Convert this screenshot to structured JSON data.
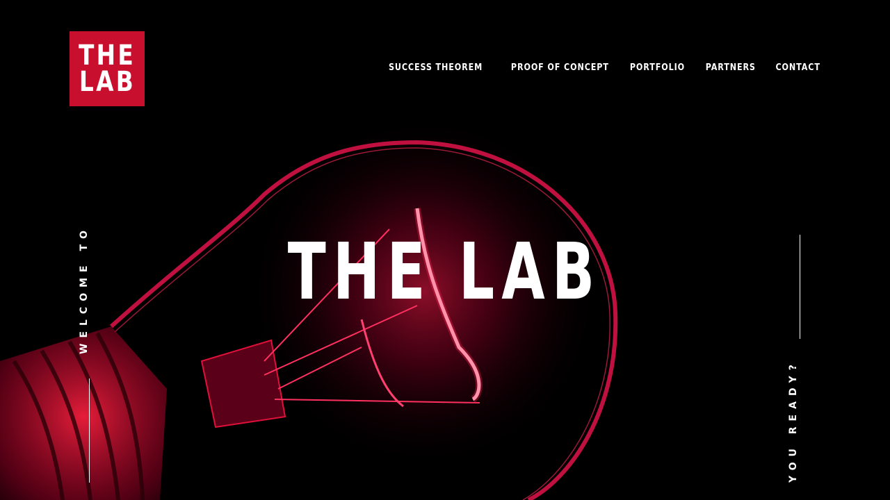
{
  "logo": {
    "line1": "THE",
    "line2": "LAB",
    "color": "#c8102e"
  },
  "nav": {
    "items": [
      {
        "label": "SUCCESS THEOREM"
      },
      {
        "label": "PROOF OF CONCEPT"
      },
      {
        "label": "PORTFOLIO"
      },
      {
        "label": "PARTNERS"
      },
      {
        "label": "CONTACT"
      }
    ]
  },
  "hero": {
    "title": "THE LAB",
    "left_caption": "WELCOME TO",
    "right_caption": "YOU READY?",
    "background": "lightbulb-image",
    "accent": "#e0103a"
  }
}
